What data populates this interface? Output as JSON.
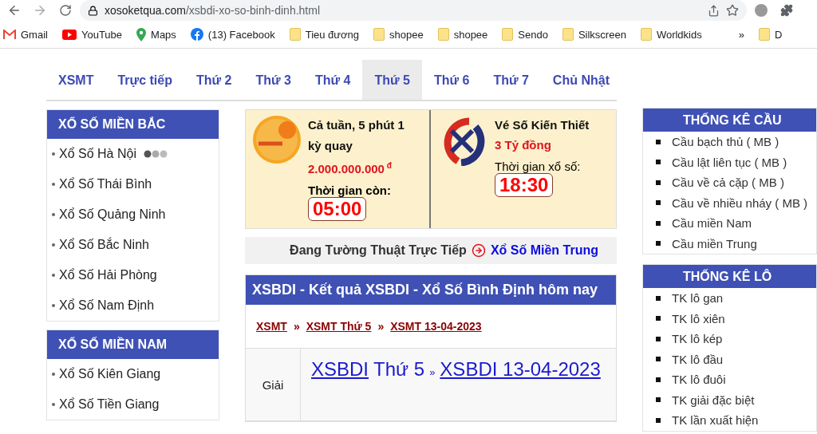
{
  "browser": {
    "url_host": "xosoketqua.com",
    "url_path": "/xsbdi-xo-so-binh-dinh.html",
    "bookmarks": [
      {
        "label": "Gmail",
        "kind": "gmail"
      },
      {
        "label": "YouTube",
        "kind": "youtube"
      },
      {
        "label": "Maps",
        "kind": "maps"
      },
      {
        "label": "(13) Facebook",
        "kind": "facebook"
      },
      {
        "label": "Tieu đương",
        "kind": "folder"
      },
      {
        "label": "shopee",
        "kind": "folder"
      },
      {
        "label": "shopee",
        "kind": "folder"
      },
      {
        "label": "Sendo",
        "kind": "folder"
      },
      {
        "label": "Silkscreen",
        "kind": "folder"
      },
      {
        "label": "Worldkids",
        "kind": "folder"
      }
    ],
    "overflow": "»",
    "cut_bookmark": "D"
  },
  "nav_tabs": [
    {
      "label": "XSMT",
      "selected": false
    },
    {
      "label": "Trực tiếp",
      "selected": false
    },
    {
      "label": "Thứ 2",
      "selected": false
    },
    {
      "label": "Thứ 3",
      "selected": false
    },
    {
      "label": "Thứ 4",
      "selected": false
    },
    {
      "label": "Thứ 5",
      "selected": true
    },
    {
      "label": "Thứ 6",
      "selected": false
    },
    {
      "label": "Thứ 7",
      "selected": false
    },
    {
      "label": "Chủ Nhật",
      "selected": false
    }
  ],
  "left_sidebar": [
    {
      "title": "XỔ SỐ MIỀN BẮC",
      "items": [
        {
          "label": "Xổ Số Hà Nội",
          "live": true
        },
        {
          "label": "Xổ Số Thái Bình",
          "live": false
        },
        {
          "label": "Xổ Số Quảng Ninh",
          "live": false
        },
        {
          "label": "Xổ Số Bắc Ninh",
          "live": false
        },
        {
          "label": "Xổ Số Hải Phòng",
          "live": false
        },
        {
          "label": "Xổ Số Nam Định",
          "live": false
        }
      ]
    },
    {
      "title": "XỔ SỐ MIỀN NAM",
      "items": [
        {
          "label": "Xổ Số Kiên Giang",
          "live": false
        },
        {
          "label": "Xổ Số Tiền Giang",
          "live": false
        }
      ]
    }
  ],
  "promo": [
    {
      "kind": "keno",
      "title": "Cả tuần, 5 phút 1 kỳ quay",
      "prize": "2.000.000.000",
      "currency": "đ",
      "time_label": "Thời gian còn:",
      "time": "05:00"
    },
    {
      "kind": "vietlott",
      "title": "Vé Số Kiến Thiết",
      "prize": "3 Tỷ đồng",
      "time_label": "Thời gian xổ số:",
      "time": "18:30"
    }
  ],
  "live_banner": {
    "text": "Đang Tường Thuật Trực Tiếp",
    "link": "Xổ Số Miền Trung"
  },
  "result": {
    "title": "XSBDI - Kết quả XSBDI - Xổ Số Bình Định hôm nay",
    "breadcrumbs": [
      "XSMT",
      "XSMT Thứ 5",
      "XSMT 13-04-2023"
    ],
    "separator": "»",
    "row_label": "Giải",
    "heading_link": "XSBDI",
    "heading_text": "Thứ 5",
    "heading_separator": "»",
    "heading_link_2": "XSBDI 13-04-2023"
  },
  "right_sidebar": [
    {
      "title": "THỐNG KÊ CẦU",
      "items": [
        "Cầu bạch thủ ( MB )",
        "Cầu lật liên tục ( MB )",
        "Cầu về cả cặp ( MB )",
        "Cầu về nhiều nháy ( MB )",
        "Cầu miền Nam",
        "Cầu miền Trung"
      ]
    },
    {
      "title": "THỐNG KÊ LÔ",
      "items": [
        "TK lô gan",
        "TK lô xiên",
        "TK lô kép",
        "TK lô đầu",
        "TK lô đuôi",
        "TK giải đặc biệt",
        "TK lần xuất hiện"
      ]
    }
  ]
}
